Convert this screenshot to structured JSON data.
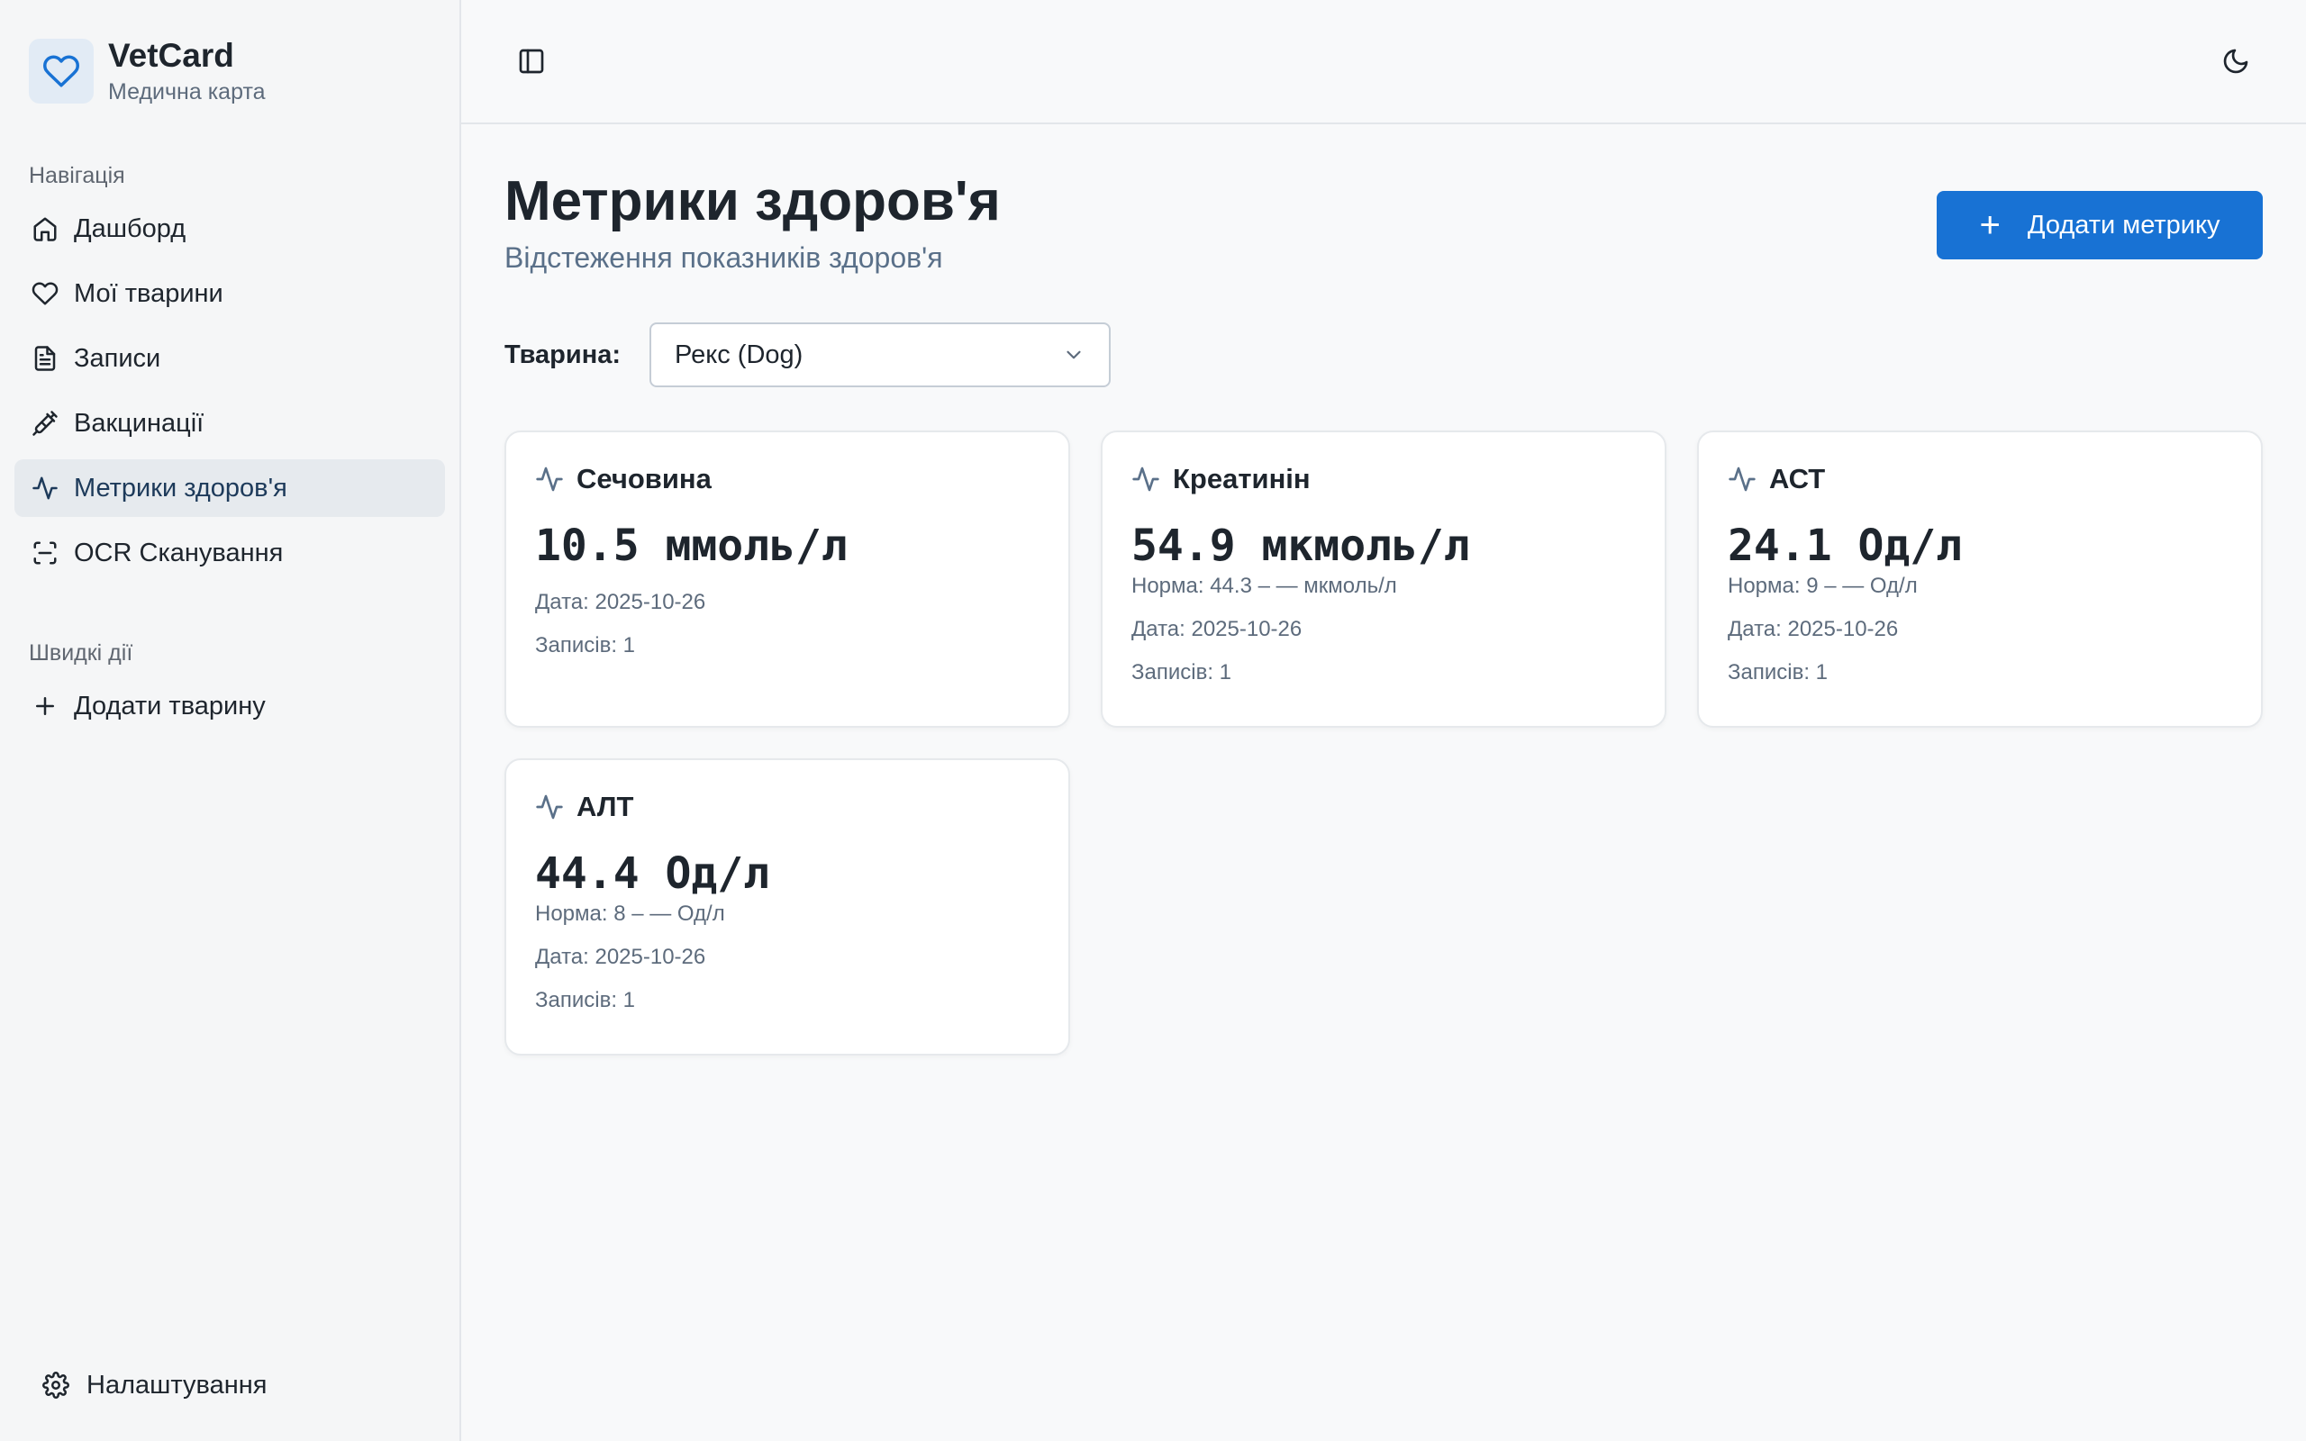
{
  "brand": {
    "title": "VetCard",
    "subtitle": "Медична карта"
  },
  "sidebar": {
    "nav_label": "Навігація",
    "items": [
      {
        "label": "Дашборд",
        "icon": "home-icon"
      },
      {
        "label": "Мої тварини",
        "icon": "heart-icon"
      },
      {
        "label": "Записи",
        "icon": "file-text-icon"
      },
      {
        "label": "Вакцинації",
        "icon": "syringe-icon"
      },
      {
        "label": "Метрики здоров'я",
        "icon": "activity-icon",
        "active": true
      },
      {
        "label": "OCR Сканування",
        "icon": "scan-icon"
      }
    ],
    "quick_label": "Швидкі дії",
    "quick_items": [
      {
        "label": "Додати тварину",
        "icon": "plus-icon"
      }
    ],
    "settings_label": "Налаштування"
  },
  "page": {
    "title": "Метрики здоров'я",
    "subtitle": "Відстеження показників здоров'я",
    "add_button": "Додати метрику"
  },
  "filter": {
    "label": "Тварина:",
    "selected": "Рекс (Dog)"
  },
  "metrics": [
    {
      "name": "Сечовина",
      "value": "10.5 ммоль/л",
      "norm": "",
      "date": "Дата: 2025-10-26",
      "records": "Записів: 1"
    },
    {
      "name": "Креатинін",
      "value": "54.9 мкмоль/л",
      "norm": "Норма: 44.3 – — мкмоль/л",
      "date": "Дата: 2025-10-26",
      "records": "Записів: 1"
    },
    {
      "name": "АСТ",
      "value": "24.1 Од/л",
      "norm": "Норма: 9 – — Од/л",
      "date": "Дата: 2025-10-26",
      "records": "Записів: 1"
    },
    {
      "name": "АЛТ",
      "value": "44.4 Од/л",
      "norm": "Норма: 8 – — Од/л",
      "date": "Дата: 2025-10-26",
      "records": "Записів: 1"
    }
  ],
  "colors": {
    "accent": "#1872d4",
    "active_bg": "#e6eaee",
    "muted": "#5d6b7c"
  }
}
